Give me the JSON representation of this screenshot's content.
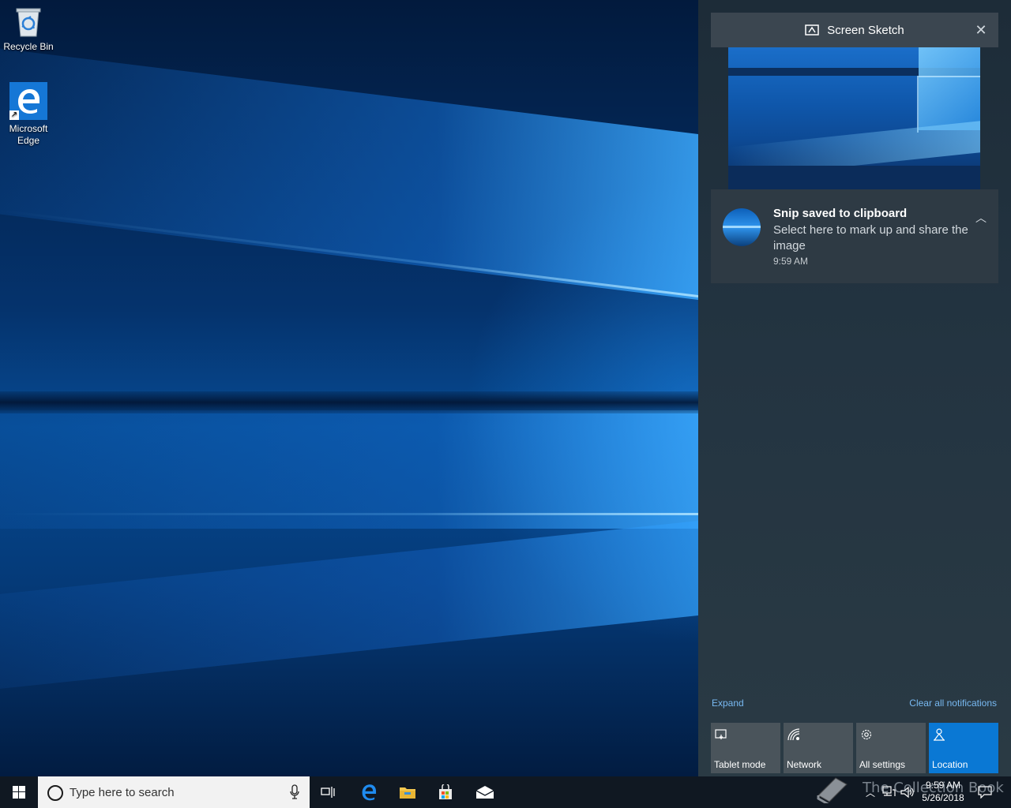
{
  "desktop": {
    "icons": [
      {
        "label": "Recycle Bin",
        "icon": "recycle-bin-icon"
      },
      {
        "label": "Microsoft\nEdge",
        "icon": "edge-icon"
      }
    ]
  },
  "action_center": {
    "group_title": "Screen Sketch",
    "notification": {
      "title": "Snip saved to clipboard",
      "body": "Select here to mark up and share the image",
      "time": "9:59 AM"
    },
    "expand_label": "Expand",
    "clear_label": "Clear all notifications",
    "quick_actions": [
      {
        "label": "Tablet mode",
        "icon": "tablet-mode-icon",
        "active": false
      },
      {
        "label": "Network",
        "icon": "network-icon",
        "active": false
      },
      {
        "label": "All settings",
        "icon": "gear-icon",
        "active": false
      },
      {
        "label": "Location",
        "icon": "location-icon",
        "active": true
      }
    ]
  },
  "taskbar": {
    "search_placeholder": "Type here to search",
    "clock_time": "9:59 AM",
    "clock_date": "5/26/2018",
    "watermark": "The Collection Book"
  },
  "colors": {
    "accent": "#0a78d4",
    "link": "#78b9f2",
    "taskbar": "#101822"
  }
}
